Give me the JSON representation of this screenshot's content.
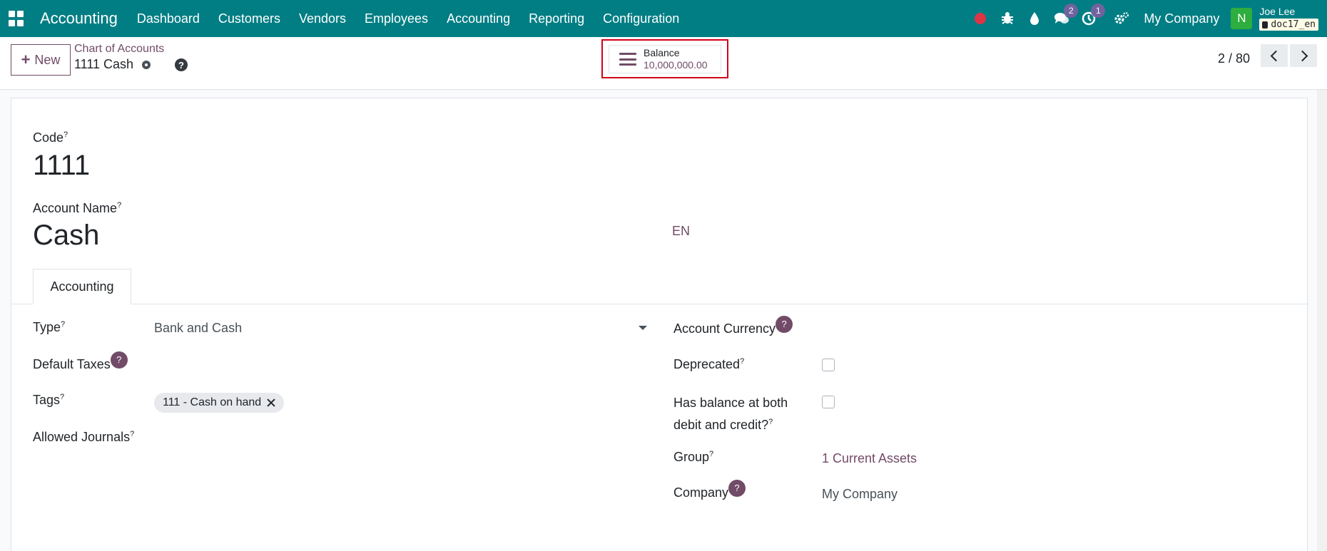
{
  "navbar": {
    "app_title": "Accounting",
    "menu": [
      "Dashboard",
      "Customers",
      "Vendors",
      "Employees",
      "Accounting",
      "Reporting",
      "Configuration"
    ],
    "chat_count": "2",
    "activity_count": "1",
    "company": "My Company",
    "avatar_letter": "N",
    "user_name": "Joe Lee",
    "database": "doc17_en"
  },
  "control_panel": {
    "new_label": "New",
    "breadcrumb_parent": "Chart of Accounts",
    "breadcrumb_current": "1111 Cash",
    "help_icon_glyph": "?",
    "smart_button": {
      "label": "Balance",
      "value": "10,000,000.00"
    },
    "pager": "2 / 80"
  },
  "form": {
    "code_label": "Code",
    "code_value": "1111",
    "name_label": "Account Name",
    "name_value": "Cash",
    "lang": "EN",
    "tab_accounting": "Accounting",
    "left_fields": {
      "type_label": "Type",
      "type_value": "Bank and Cash",
      "default_taxes_label": "Default Taxes",
      "tags_label": "Tags",
      "tag_value": "111 - Cash on hand",
      "allowed_journals_label": "Allowed Journals"
    },
    "right_fields": {
      "currency_label": "Account Currency",
      "deprecated_label": "Deprecated",
      "balance_both_label_1": "Has balance at both",
      "balance_both_label_2": "debit and credit?",
      "group_label": "Group",
      "group_value": "1 Current Assets",
      "company_label": "Company",
      "company_value": "My Company"
    },
    "tooltip_marker": "?",
    "help_badge": "?"
  },
  "colors": {
    "navbar": "#017e84",
    "primary": "#714b67",
    "highlight_frame": "#d0021b",
    "avatar": "#2dae3e"
  }
}
